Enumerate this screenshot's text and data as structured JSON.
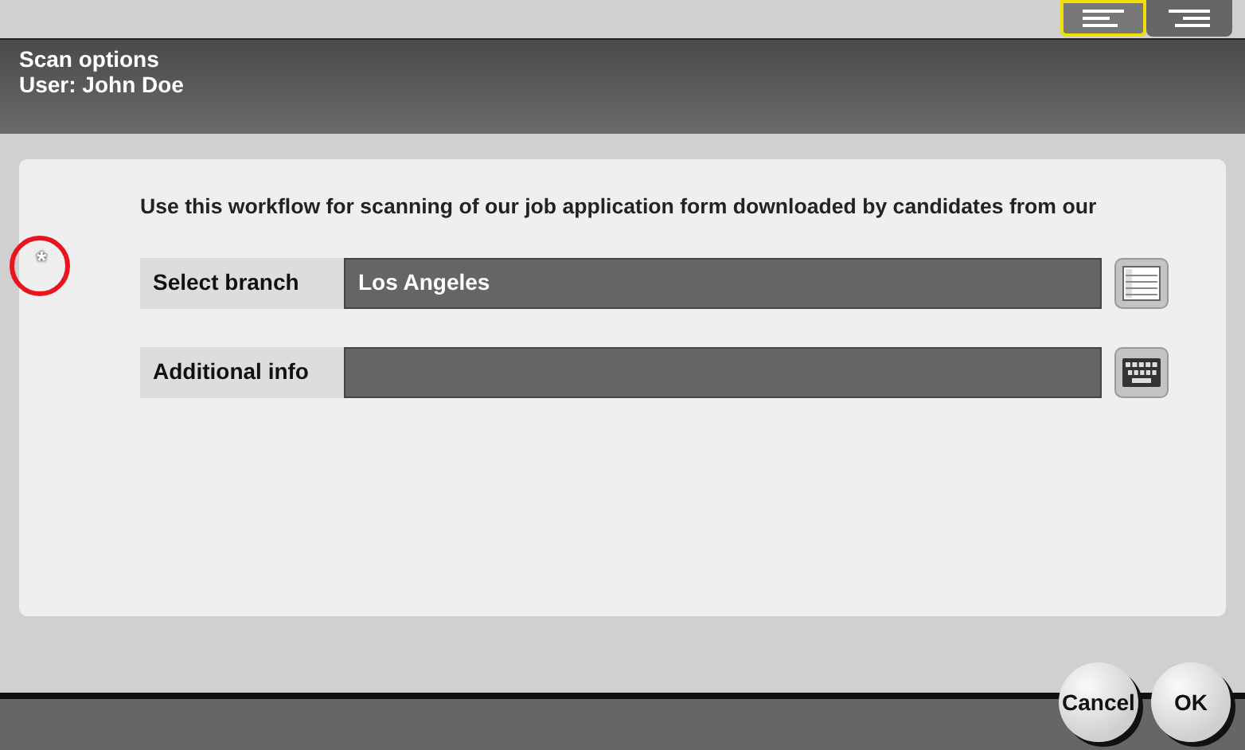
{
  "view_toggles": [
    {
      "kind": "left",
      "selected": true
    },
    {
      "kind": "right",
      "selected": false
    }
  ],
  "header": {
    "title": "Scan options",
    "user": "User: John Doe"
  },
  "required_mark": "*",
  "description": "Use this workflow for scanning of our job application form downloaded by candidates from our",
  "fields": [
    {
      "label": "Select branch",
      "value": "Los Angeles",
      "kind": "list"
    },
    {
      "label": "Additional info",
      "kind": "keyboard"
    }
  ],
  "buttons": [
    "Cancel",
    "OK"
  ]
}
